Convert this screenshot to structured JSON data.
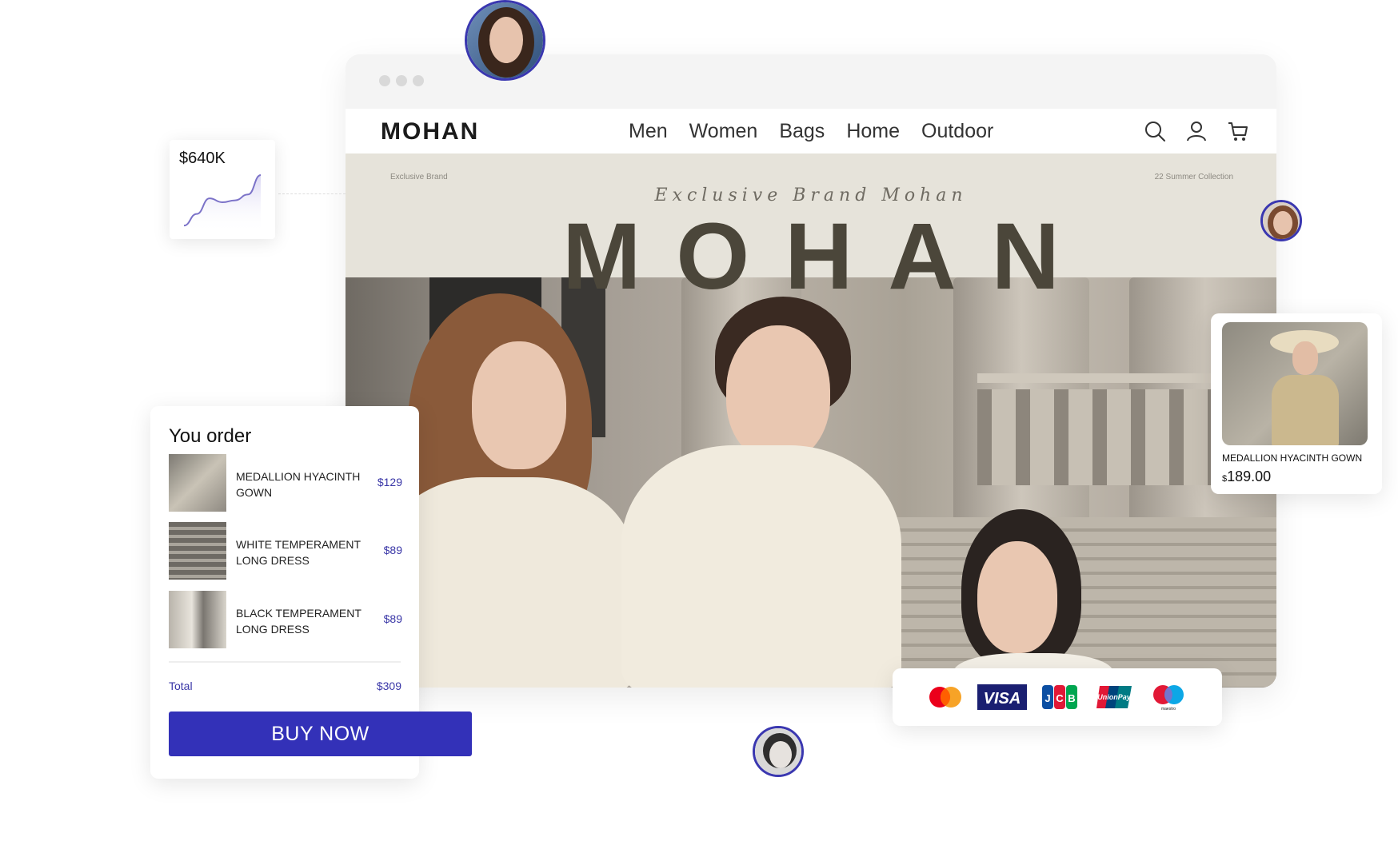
{
  "browser": {
    "brand": "MOHAN",
    "menu": [
      "Men",
      "Women",
      "Bags",
      "Home",
      "Outdoor"
    ],
    "icons": [
      "search-icon",
      "user-icon",
      "cart-icon"
    ]
  },
  "hero": {
    "left_label": "Exclusive Brand",
    "right_label": "22 Summer Collection",
    "script_text": "Exclusive Brand Mohan",
    "title": "MOHAN"
  },
  "stats": {
    "value": "$640K",
    "chart_data": {
      "type": "area",
      "x": [
        1,
        2,
        3,
        4,
        5,
        6,
        7
      ],
      "values": [
        2,
        8,
        16,
        14,
        15,
        18,
        28
      ],
      "color": "#7b72c8"
    }
  },
  "order": {
    "title": "You order",
    "items": [
      {
        "name": "MEDALLION HYACINTH GOWN",
        "price": "$129"
      },
      {
        "name": "WHITE TEMPERAMENT LONG DRESS",
        "price": "$89"
      },
      {
        "name": "BLACK TEMPERAMENT LONG DRESS",
        "price": "$89"
      }
    ],
    "total_label": "Total",
    "total_value": "$309",
    "buy_label": "BUY NOW"
  },
  "product": {
    "name": "MEDALLION HYACINTH GOWN",
    "currency": "$",
    "price": "189.00"
  },
  "payments": {
    "methods": [
      "Mastercard",
      "VISA",
      "JCB",
      "UnionPay",
      "maestro"
    ]
  },
  "colors": {
    "accent": "#3331b8",
    "price_text": "#3a37a7"
  }
}
